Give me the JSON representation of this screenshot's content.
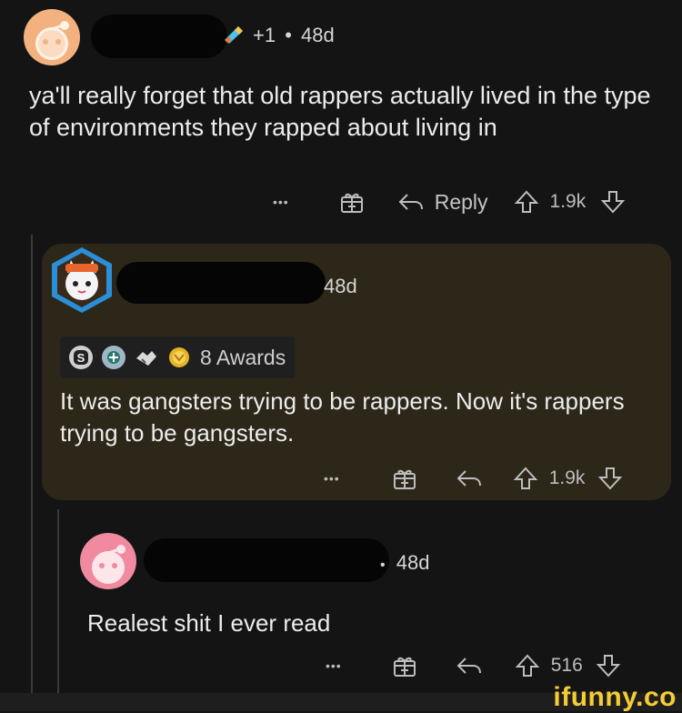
{
  "comment1": {
    "meta_score": "+1",
    "meta_sep": "•",
    "meta_age": "48d",
    "text": "ya'll really forget that old rappers actually lived in the type of environments they rapped about living in",
    "actions": {
      "more": "•••",
      "reply": "Reply",
      "score": "1.9k"
    }
  },
  "comment2": {
    "age": "48d",
    "awards_label": "8 Awards",
    "text": "It was gangsters trying to be rappers. Now it's rappers trying to be gangsters.",
    "actions": {
      "more": "•••",
      "score": "1.9k"
    }
  },
  "comment3": {
    "meta_sep": "•",
    "age": "48d",
    "text": "Realest shit I ever read",
    "actions": {
      "more": "•••",
      "score": "516"
    }
  },
  "watermark": "ifunny.co",
  "colors": {
    "background": "#141414",
    "highlight": "#2c2719",
    "watermark": "#f5cc32"
  }
}
